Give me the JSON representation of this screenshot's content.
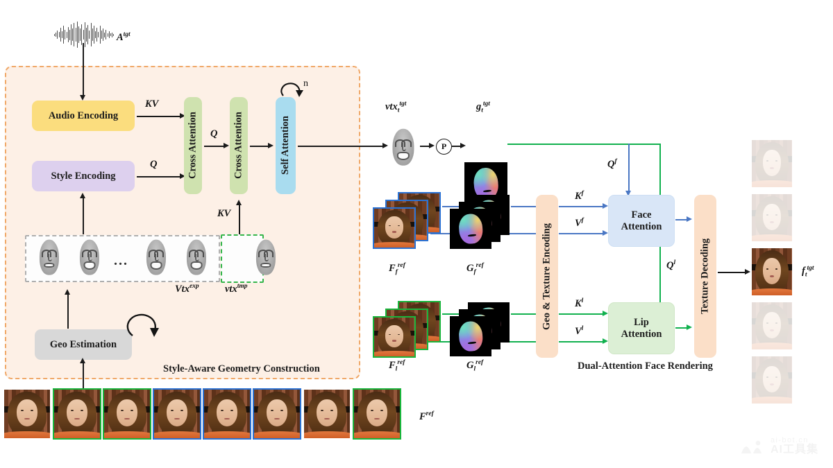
{
  "figure": {
    "title": "Style-Aware Geometry Construction and Dual-Attention Face Rendering pipeline"
  },
  "colors": {
    "panel_left_border": "#f0a868",
    "panel_left_fill": "#fdf0e6",
    "panel_right_border": "#8ab4df",
    "panel_right_fill": "#eef3fa",
    "audio_box": "#fbdd7e",
    "style_box": "#ddd0ee",
    "attention_box": "#cfe2af",
    "self_attention_box": "#a9dcef",
    "geo_box": "#d8d8d8",
    "peach_box": "#fbdfc8",
    "face_attention_box": "#d9e6f7",
    "lip_attention_box": "#dcefd5",
    "flow_blue": "#4a77c4",
    "flow_green": "#11b14e",
    "frame_green": "#19b53c",
    "frame_blue": "#2a72d4"
  },
  "left_panel": {
    "caption": "Style-Aware Geometry Construction",
    "audio_input_label": "A",
    "audio_input_sup": "tgt",
    "blocks": {
      "audio_encoding": "Audio Encoding",
      "style_encoding": "Style Encoding",
      "cross_attention_1": "Cross Attention",
      "cross_attention_2": "Cross Attention",
      "self_attention": "Self Attention",
      "geo_estimation": "Geo Estimation"
    },
    "edge_labels": {
      "audio_to_cross1": "KV",
      "style_to_cross1": "Q",
      "cross1_to_cross2": "Q",
      "template_to_cross2": "KV",
      "self_attention_repeat": "n"
    },
    "vertex_sequence": {
      "exp_label": "Vtx",
      "exp_sup": "exp",
      "tmp_label": "vtx",
      "tmp_sup": "tmp",
      "ellipsis": "...",
      "exp_count": 4,
      "tmp_count": 1
    }
  },
  "middle": {
    "vtx_target_label": "vtx",
    "vtx_target_sub": "t",
    "vtx_target_sup": "tgt",
    "projection_node": "P",
    "geo_target_label": "g",
    "geo_target_sub": "t",
    "geo_target_sup": "tgt"
  },
  "right_panel": {
    "caption": "Dual-Attention Face Rendering",
    "blocks": {
      "geo_texture_encoding": "Geo & Texture Encoding",
      "face_attention": "Face\nAttention",
      "face_attention_line1": "Face",
      "face_attention_line2": "Attention",
      "lip_attention_line1": "Lip",
      "lip_attention_line2": "Attention",
      "texture_decoding": "Texture Decoding"
    },
    "inputs": {
      "face_frames_label": "F",
      "face_frames_sub": "f",
      "face_frames_sup": "ref",
      "face_geo_label": "G",
      "face_geo_sub": "f",
      "face_geo_sup": "ref",
      "lip_frames_label": "F",
      "lip_frames_sub": "l",
      "lip_frames_sup": "ref",
      "lip_geo_label": "G",
      "lip_geo_sub": "l",
      "lip_geo_sup": "ref"
    },
    "edge_labels": {
      "k_face": "K",
      "k_face_sup": "f",
      "v_face": "V",
      "v_face_sup": "f",
      "k_lip": "K",
      "k_lip_sup": "l",
      "v_lip": "V",
      "v_lip_sup": "l",
      "q_face": "Q",
      "q_face_sup": "f",
      "q_lip": "Q",
      "q_lip_sup": "l"
    }
  },
  "bottom_frames": {
    "label": "F",
    "label_sup": "ref",
    "count": 8,
    "frame_colors": [
      "none",
      "green",
      "green",
      "blue",
      "blue",
      "blue",
      "none",
      "green"
    ]
  },
  "output_column": {
    "label": "f",
    "label_sub": "t",
    "label_sup": "tgt",
    "count": 5,
    "highlighted_index": 2
  },
  "watermark": {
    "url": "ai-bot.cn",
    "brand": "AI工具集"
  }
}
